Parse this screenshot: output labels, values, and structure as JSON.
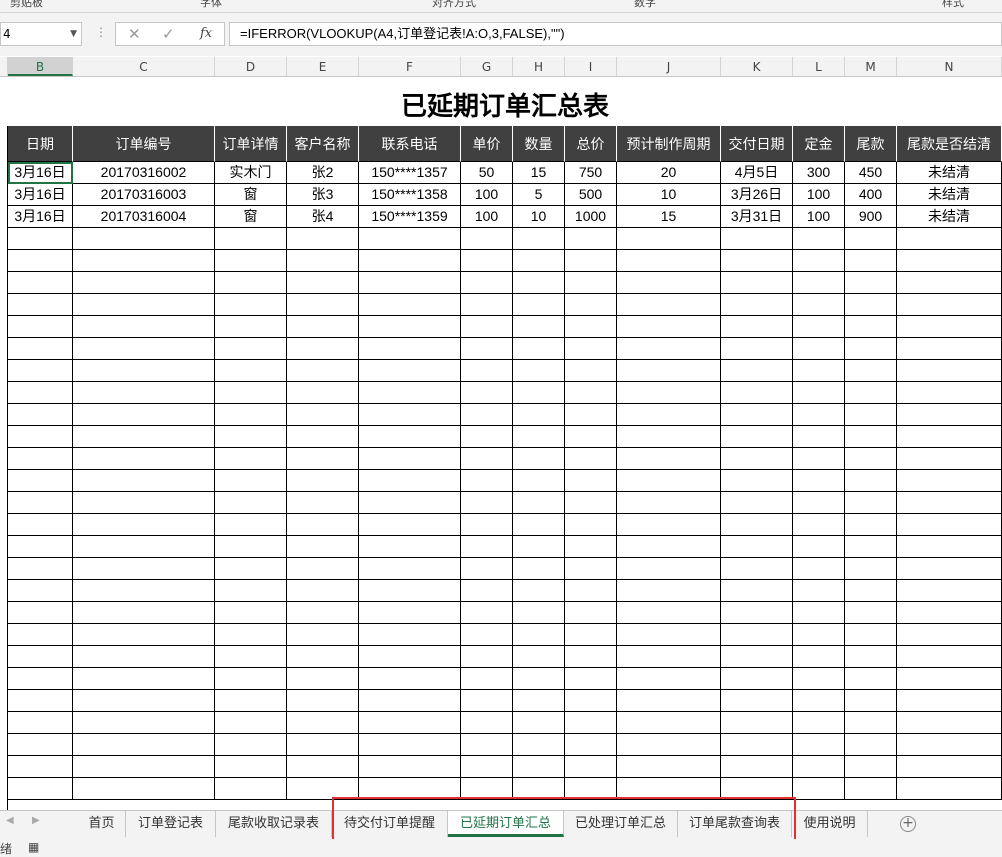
{
  "ribbon_groups": [
    "剪贴板",
    "字体",
    "对齐方式",
    "数字",
    "样式"
  ],
  "formula_bar": {
    "name_box": "4",
    "cancel_symbol": "✕",
    "enter_symbol": "✓",
    "fx_label": "fx",
    "formula": "=IFERROR(VLOOKUP(A4,订单登记表!A:O,3,FALSE),\"\")"
  },
  "column_letters": [
    "B",
    "C",
    "D",
    "E",
    "F",
    "G",
    "H",
    "I",
    "J",
    "K",
    "L",
    "M",
    "N"
  ],
  "sheet_title": "已延期订单汇总表",
  "table": {
    "headers": [
      "日期",
      "订单编号",
      "订单详情",
      "客户名称",
      "联系电话",
      "单价",
      "数量",
      "总价",
      "预计制作周期",
      "交付日期",
      "定金",
      "尾款",
      "尾款是否结清"
    ],
    "rows": [
      [
        "3月16日",
        "20170316002",
        "实木门",
        "张2",
        "150****1357",
        "50",
        "15",
        "750",
        "20",
        "4月5日",
        "300",
        "450",
        "未结清"
      ],
      [
        "3月16日",
        "20170316003",
        "窗",
        "张3",
        "150****1358",
        "100",
        "5",
        "500",
        "10",
        "3月26日",
        "100",
        "400",
        "未结清"
      ],
      [
        "3月16日",
        "20170316004",
        "窗",
        "张4",
        "150****1359",
        "100",
        "10",
        "1000",
        "15",
        "3月31日",
        "100",
        "900",
        "未结清"
      ]
    ]
  },
  "sheet_tabs": [
    {
      "label": "首页",
      "active": false
    },
    {
      "label": "订单登记表",
      "active": false
    },
    {
      "label": "尾款收取记录表",
      "active": false
    },
    {
      "label": "待交付订单提醒",
      "active": false
    },
    {
      "label": "已延期订单汇总",
      "active": true
    },
    {
      "label": "已处理订单汇总",
      "active": false
    },
    {
      "label": "订单尾款查询表",
      "active": false
    },
    {
      "label": "使用说明",
      "active": false
    }
  ],
  "add_sheet_symbol": "+",
  "status": {
    "text": "绪"
  },
  "colors": {
    "accent": "#217346",
    "header_bg": "#404040",
    "highlight": "#e03030"
  }
}
